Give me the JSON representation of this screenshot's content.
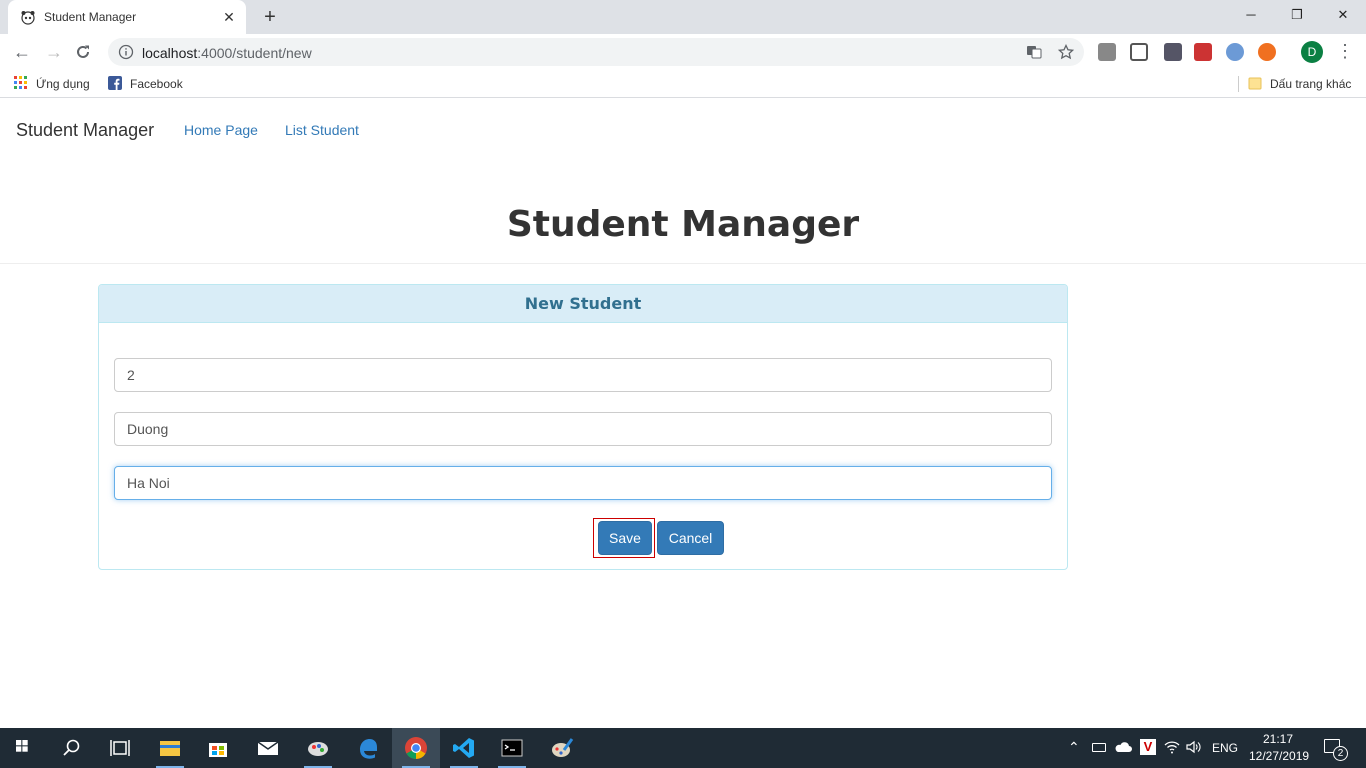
{
  "browser": {
    "tab_title": "Student Manager",
    "tab_close": "✕",
    "new_tab": "+",
    "url_host": "localhost",
    "url_path": ":4000/student/new",
    "window_controls": {
      "minimize": "─",
      "maximize": "❐",
      "close": "✕"
    },
    "profile_initial": "D",
    "bookmarks": {
      "apps": "Ứng dụng",
      "facebook": "Facebook",
      "other": "Dấu trang khác"
    }
  },
  "navbar": {
    "brand": "Student Manager",
    "links": [
      "Home Page",
      "List Student"
    ]
  },
  "page_title": "Student Manager",
  "panel": {
    "heading": "New Student",
    "fields": [
      "2",
      "Duong",
      "Ha Noi"
    ],
    "save_label": "Save",
    "cancel_label": "Cancel"
  },
  "taskbar": {
    "time": "21:17",
    "date": "12/27/2019",
    "language": "ENG",
    "notifications": "2"
  },
  "colors": {
    "link": "#337ab7",
    "panel_heading_bg": "#d9edf7",
    "panel_heading_text": "#31708f",
    "button_primary": "#337ab7",
    "taskbar_bg": "#1f2b35"
  }
}
